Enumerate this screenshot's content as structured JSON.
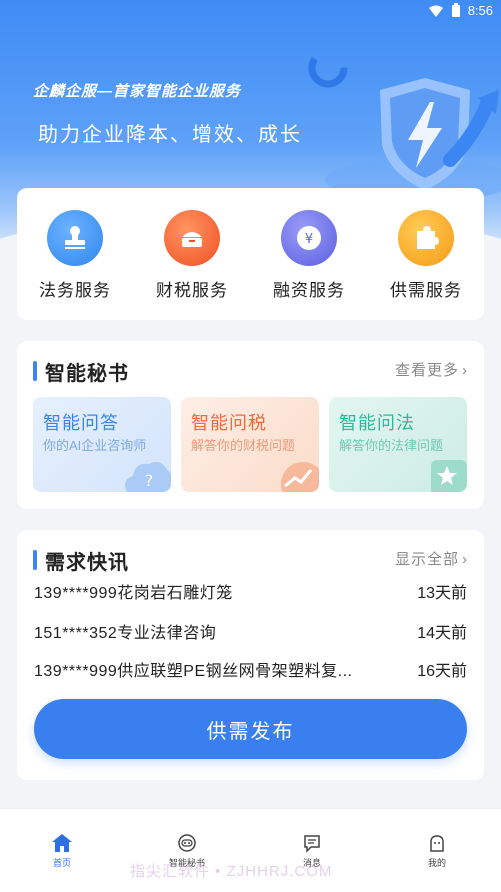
{
  "status_bar": {
    "time": "8:56"
  },
  "banner": {
    "slogan": "企麟企服—首家智能企业服务",
    "subtitle": "助力企业降本、增效、成长"
  },
  "services": [
    {
      "label": "法务服务",
      "icon": "stamp-icon",
      "color": "#3b8cf0"
    },
    {
      "label": "财税服务",
      "icon": "tax-box-icon",
      "color": "#f06a3a"
    },
    {
      "label": "融资服务",
      "icon": "yuan-coin-icon",
      "color": "#6b70e8"
    },
    {
      "label": "供需服务",
      "icon": "puzzle-icon",
      "color": "#f5a623"
    }
  ],
  "secretary": {
    "title": "智能秘书",
    "more": "查看更多",
    "cards": [
      {
        "title": "智能问答",
        "desc": "你的AI企业咨询师",
        "icon": "cloud-question-icon"
      },
      {
        "title": "智能问税",
        "desc": "解答你的财税问题",
        "icon": "chart-trend-icon"
      },
      {
        "title": "智能问法",
        "desc": "解答你的法律问题",
        "icon": "star-badge-icon"
      }
    ]
  },
  "news": {
    "title": "需求快讯",
    "more": "显示全部",
    "items": [
      {
        "text": "139****999花岗岩石雕灯笼",
        "time": "13天前"
      },
      {
        "text": "151****352专业法律咨询",
        "time": "14天前"
      },
      {
        "text": "139****999供应联塑PE钢丝网骨架塑料复...",
        "time": "16天前"
      }
    ],
    "publish_label": "供需发布"
  },
  "tabbar": [
    {
      "label": "首页",
      "icon": "home-icon",
      "active": true
    },
    {
      "label": "智能秘书",
      "icon": "robot-icon",
      "active": false
    },
    {
      "label": "消息",
      "icon": "message-icon",
      "active": false
    },
    {
      "label": "我的",
      "icon": "profile-icon",
      "active": false
    }
  ],
  "watermark": "指尖汇软件 • ZJHHRJ.COM",
  "colors": {
    "primary": "#3a7ff0",
    "tab_active": "#2f6fe6",
    "tab_inactive": "#444444"
  }
}
